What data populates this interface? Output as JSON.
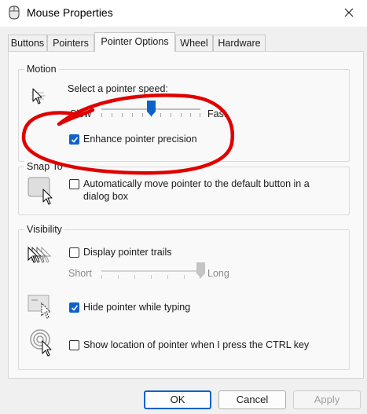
{
  "window": {
    "title": "Mouse Properties"
  },
  "tabs": [
    {
      "label": "Buttons",
      "active": false
    },
    {
      "label": "Pointers",
      "active": false
    },
    {
      "label": "Pointer Options",
      "active": true
    },
    {
      "label": "Wheel",
      "active": false
    },
    {
      "label": "Hardware",
      "active": false
    }
  ],
  "motion": {
    "group_label": "Motion",
    "speed_prompt": "Select a pointer speed:",
    "slow_label": "Slow",
    "fast_label": "Fast",
    "speed_level": 0.5,
    "enhance_precision": {
      "label": "Enhance pointer precision",
      "checked": true
    }
  },
  "snap_to": {
    "group_label": "Snap To",
    "auto_move": {
      "label_line1": "Automatically move pointer to the default button in a",
      "label_line2": "dialog box",
      "checked": false
    }
  },
  "visibility": {
    "group_label": "Visibility",
    "trails": {
      "label": "Display pointer trails",
      "checked": false
    },
    "short_label": "Short",
    "long_label": "Long",
    "trail_length_level": 1.0,
    "hide_while_typing": {
      "label": "Hide pointer while typing",
      "checked": true
    },
    "show_location": {
      "label": "Show location of pointer when I press the CTRL key",
      "checked": false
    }
  },
  "buttons": {
    "ok": "OK",
    "cancel": "Cancel",
    "apply": "Apply"
  },
  "colors": {
    "accent": "#0f62c8",
    "annotation": "#e00000"
  }
}
